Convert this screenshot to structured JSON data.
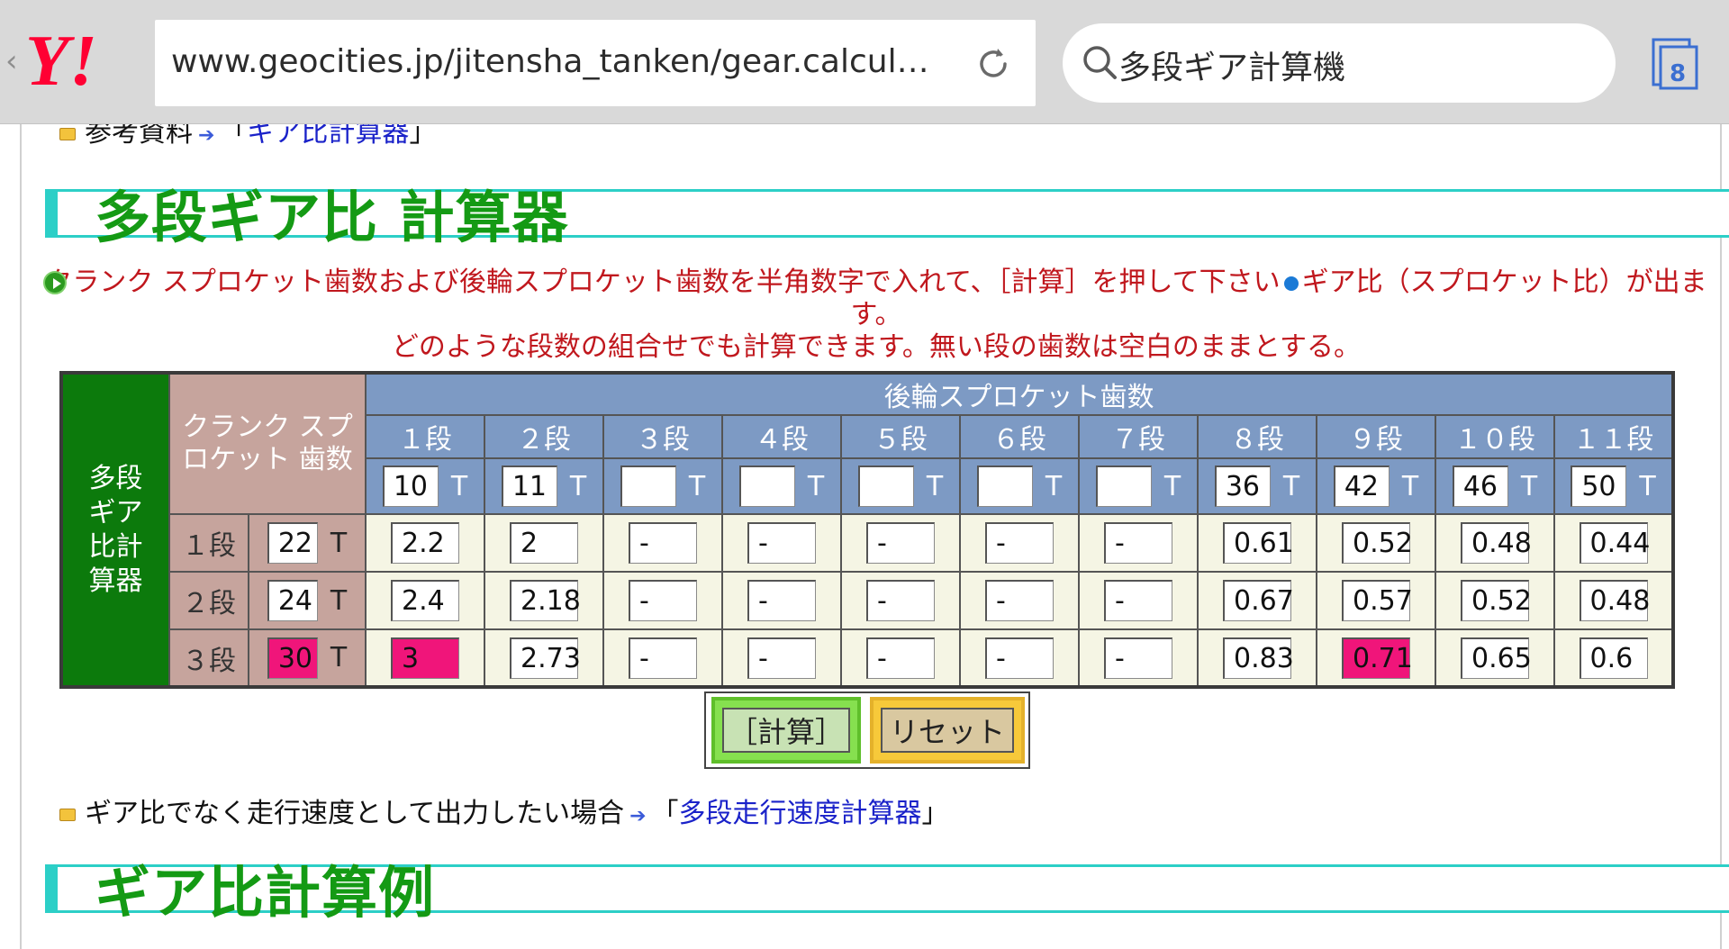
{
  "browser": {
    "url": "www.geocities.jp/jitensha_tanken/gear.calculator.h⋯",
    "search_query": "多段ギア計算機",
    "tab_count": "8"
  },
  "page": {
    "ref": {
      "label": "参考資料",
      "link_text": "ギア比計算器",
      "open": "「",
      "close": "」"
    },
    "heading1": "多段ギア比 計算器",
    "instructions": {
      "line1": "クランク スプロケット歯数および後輪スプロケット歯数を半角数字で入れて、［計算］を押して下さい",
      "line1b": "ギア比（スプロケット比）が出ます。",
      "line2": "どのような段数の組合せでも計算できます。無い段の歯数は空白のままとする。"
    },
    "table": {
      "title": "多段ギア比計算器",
      "crank_header": "クランク スプロケット 歯数",
      "rear_header": "後輪スプロケット歯数",
      "t": "T",
      "rear_stages": [
        "１段",
        "２段",
        "３段",
        "４段",
        "５段",
        "６段",
        "７段",
        "８段",
        "９段",
        "１０段",
        "１１段"
      ],
      "rear_teeth": [
        "10",
        "11",
        "",
        "",
        "",
        "",
        "",
        "36",
        "42",
        "46",
        "50"
      ],
      "rows": [
        {
          "label": "１段",
          "teeth": "22",
          "ratios": [
            "2.2",
            "2",
            "-",
            "-",
            "-",
            "-",
            "-",
            "0.61",
            "0.52",
            "0.48",
            "0.44"
          ]
        },
        {
          "label": "２段",
          "teeth": "24",
          "ratios": [
            "2.4",
            "2.18",
            "-",
            "-",
            "-",
            "-",
            "-",
            "0.67",
            "0.57",
            "0.52",
            "0.48"
          ]
        },
        {
          "label": "３段",
          "teeth": "30",
          "ratios": [
            "3",
            "2.73",
            "-",
            "-",
            "-",
            "-",
            "-",
            "0.83",
            "0.71",
            "0.65",
            "0.6"
          ]
        }
      ]
    },
    "buttons": {
      "calc": "［計算］",
      "reset": "リセット"
    },
    "alt": {
      "text": "ギア比でなく走行速度として出力したい場合",
      "link_text": "多段走行速度計算器",
      "open": "「",
      "close": "」"
    },
    "heading2": "ギア比計算例"
  },
  "colors": {
    "heading_green": "#149a14",
    "accent_teal": "#2ccfc7",
    "instruction_red": "#c0171d",
    "highlight_pink": "#f0157a",
    "table_blue": "#7d9ac4",
    "table_rose": "#c6a49d"
  }
}
